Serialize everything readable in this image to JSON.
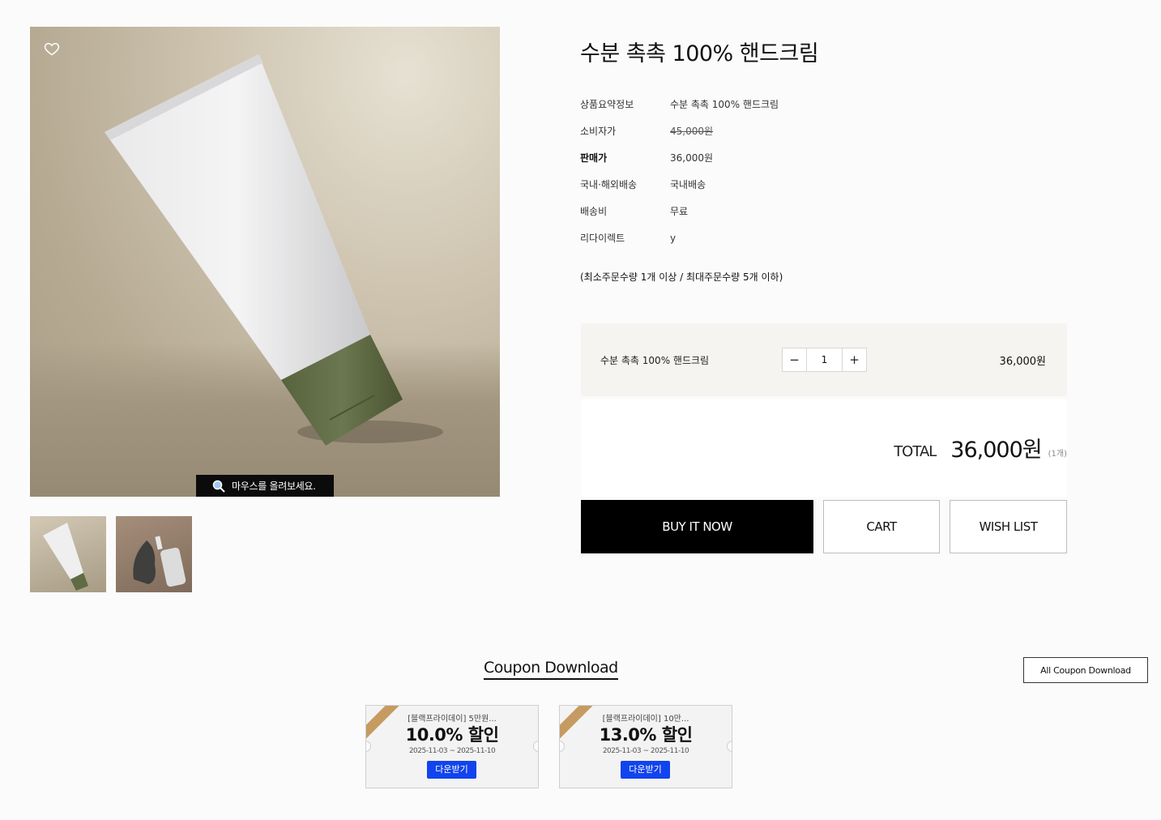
{
  "product": {
    "title": "수분 촉촉 100% 핸드크림",
    "zoom_tip": "마우스를 올려보세요.",
    "info": [
      {
        "key": "상품요약정보",
        "value": "수분 촉촉 100% 핸드크림"
      },
      {
        "key": "소비자가",
        "value": "45,000원"
      },
      {
        "key": "판매가",
        "value": "36,000원"
      },
      {
        "key": "국내·해외배송",
        "value": "국내배송"
      },
      {
        "key": "배송비",
        "value": "무료"
      },
      {
        "key": "리다이렉트",
        "value": "y"
      }
    ],
    "order_limit": "(최소주문수량 1개 이상 / 최대주문수량 5개 이하)"
  },
  "option": {
    "name": "수분 촉촉 100% 핸드크림",
    "minus": "−",
    "quantity": "1",
    "plus": "+",
    "price": "36,000원"
  },
  "total": {
    "label": "TOTAL",
    "amount": "36,000원",
    "count": "(1개)"
  },
  "buttons": {
    "buy": "BUY IT NOW",
    "cart": "CART",
    "wish": "WISH LIST"
  },
  "coupons": {
    "title": "Coupon Download",
    "all_button": "All Coupon Download",
    "items": [
      {
        "name": "[블랙프라이데이] 5만원...",
        "rate": "10.0% 할인",
        "period": "2025-11-03 ~ 2025-11-10",
        "button": "다운받기"
      },
      {
        "name": "[블랙프라이데이] 10만...",
        "rate": "13.0% 할인",
        "period": "2025-11-03 ~ 2025-11-10",
        "button": "다운받기"
      }
    ]
  },
  "colors": {
    "accent_blue": "#1144ee",
    "ribbon": "#c69b62",
    "option_bg": "#f6f4f0",
    "cap_green": "#5f6b43"
  }
}
